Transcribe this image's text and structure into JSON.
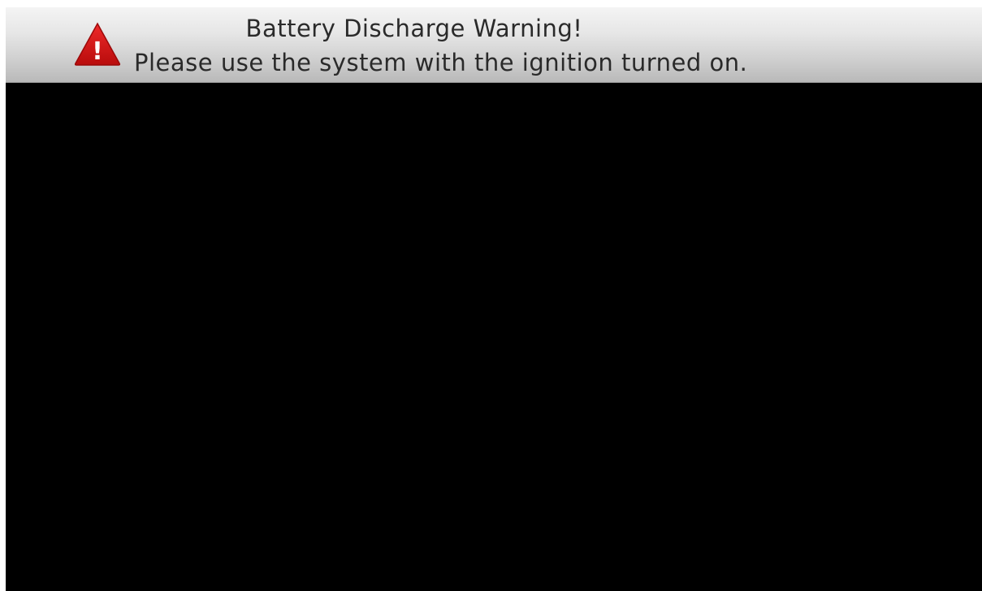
{
  "warning": {
    "title": "Battery Discharge Warning!",
    "message": "Please use the system with the ignition turned on.",
    "icon": "warning-triangle-icon",
    "icon_color": "#d41414",
    "icon_symbol": "!"
  },
  "colors": {
    "screen_background": "#000000",
    "banner_text": "#2a2a2a"
  }
}
